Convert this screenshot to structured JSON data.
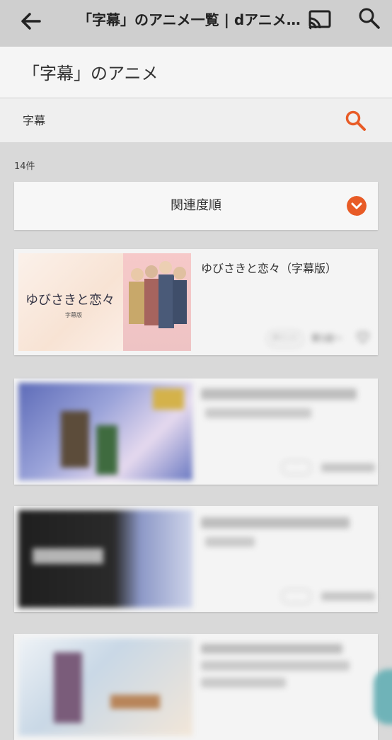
{
  "topbar": {
    "title": "「字幕」のアニメ一覧 | dアニメストア",
    "icons": {
      "back": "back-arrow-icon",
      "cast": "cast-icon",
      "search": "search-icon"
    }
  },
  "header": {
    "page_title": "「字幕」のアニメ"
  },
  "search": {
    "query": "字幕"
  },
  "results": {
    "count": "14件"
  },
  "sort": {
    "label": "関連度順"
  },
  "cards": [
    {
      "title": "ゆびさきと恋々（字幕版）",
      "chip": "ポイント",
      "meta": "第1話〜",
      "thumb_text": "ゆびさきと恋々",
      "thumb_sub": "字幕版"
    },
    {
      "title": ""
    },
    {
      "title": ""
    },
    {
      "title": ""
    }
  ],
  "colors": {
    "accent": "#e85b26",
    "bg": "#d9d9d9"
  }
}
